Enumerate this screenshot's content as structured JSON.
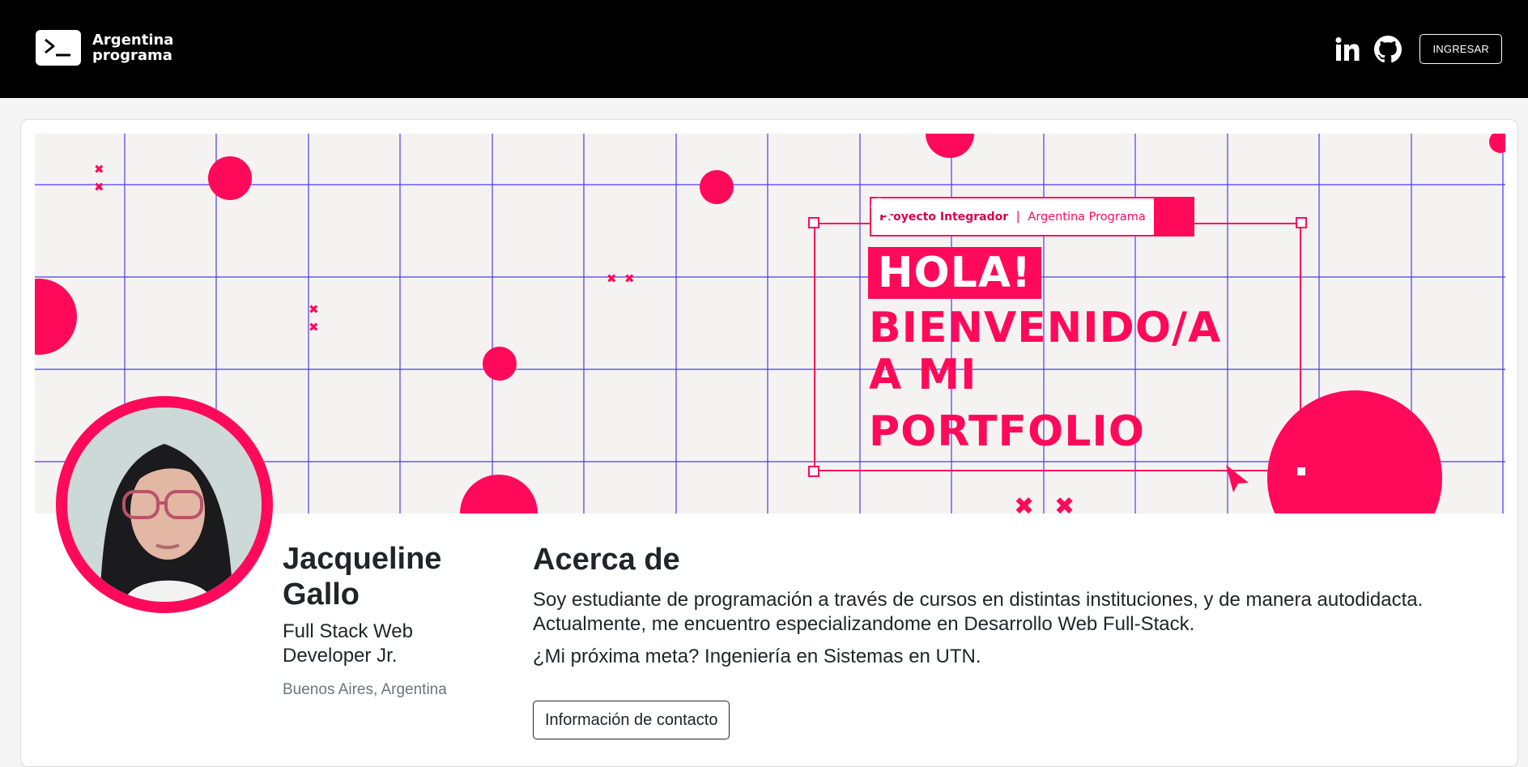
{
  "navbar": {
    "brand_line1": "Argentina",
    "brand_line2": "programa",
    "login_label": "INGRESAR",
    "icons": [
      "linkedin-icon",
      "github-icon"
    ]
  },
  "banner": {
    "tag_strong": "Proyecto Integrador",
    "tag_separator": "|",
    "tag_light": "Argentina Programa",
    "hola": "HOLA!",
    "line2": "BIENVENIDO/A",
    "line3": "A MI",
    "line4": "PORTFOLIO"
  },
  "profile": {
    "name_line1": "Jacqueline",
    "name_line2": "Gallo",
    "role": "Full Stack Web Developer Jr.",
    "location": "Buenos Aires, Argentina"
  },
  "about": {
    "title": "Acerca de",
    "text": "Soy estudiante de programación a través de cursos en distintas instituciones, y de manera autodidacta. Actualmente, me encuentro especializandome en Desarrollo Web Full-Stack.",
    "goal": "¿Mi próxima meta? Ingeniería en Sistemas en UTN.",
    "contact_button": "Información de contacto"
  },
  "colors": {
    "accent": "#ff0a5a",
    "grid": "#4a3cf0",
    "navbar": "#000000"
  }
}
